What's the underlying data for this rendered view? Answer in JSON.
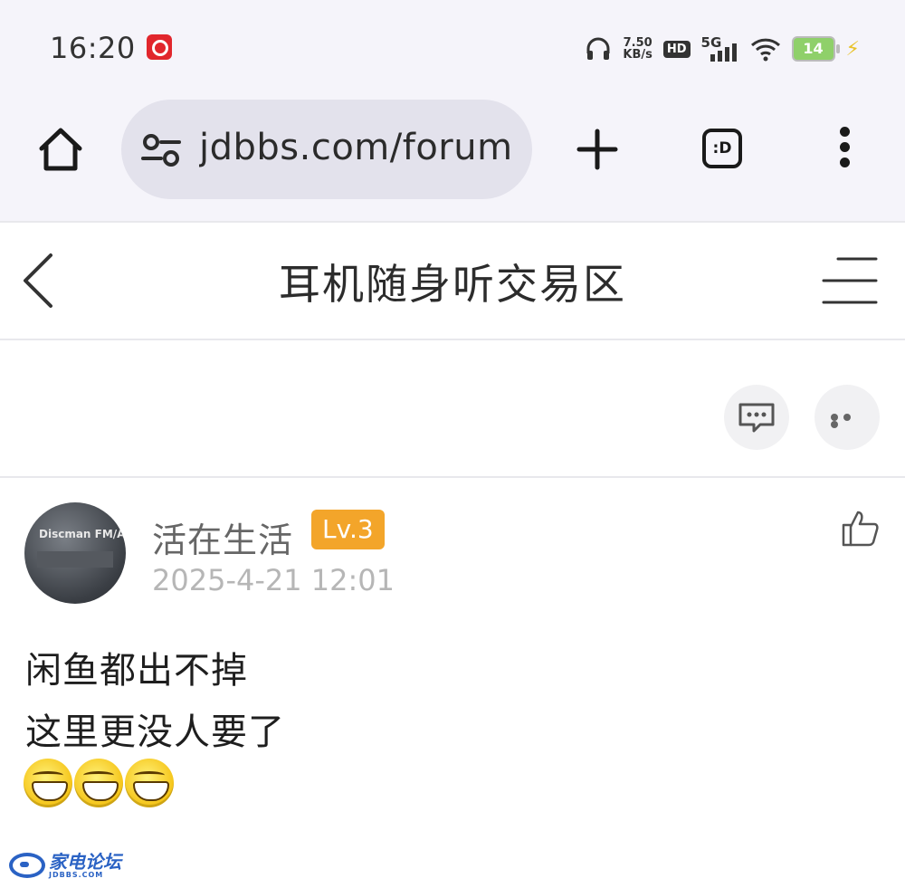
{
  "status_bar": {
    "time": "16:20",
    "net_speed_value": "7.50",
    "net_speed_unit": "KB/s",
    "hd_label": "HD",
    "network": "5G",
    "battery": "14"
  },
  "browser": {
    "url": "jdbbs.com/forum.",
    "tabs_label": ":D"
  },
  "forum": {
    "title": "耳机随身听交易区"
  },
  "post": {
    "author": "活在生活",
    "level": "Lv.3",
    "time": "2025-4-21 12:01",
    "avatar_text": "Discman FM/AM",
    "lines": [
      "闲鱼都出不掉",
      "这里更没人要了"
    ],
    "emoji": [
      "grin-emoji",
      "grin-emoji",
      "grin-emoji"
    ]
  },
  "watermark": {
    "title": "家电论坛",
    "subtitle": "JDBBS.COM"
  },
  "colors": {
    "level_badge": "#f3a52a",
    "chrome_bg": "#f5f4fa",
    "url_pill": "#e3e2ec",
    "watermark": "#2a62c4"
  }
}
